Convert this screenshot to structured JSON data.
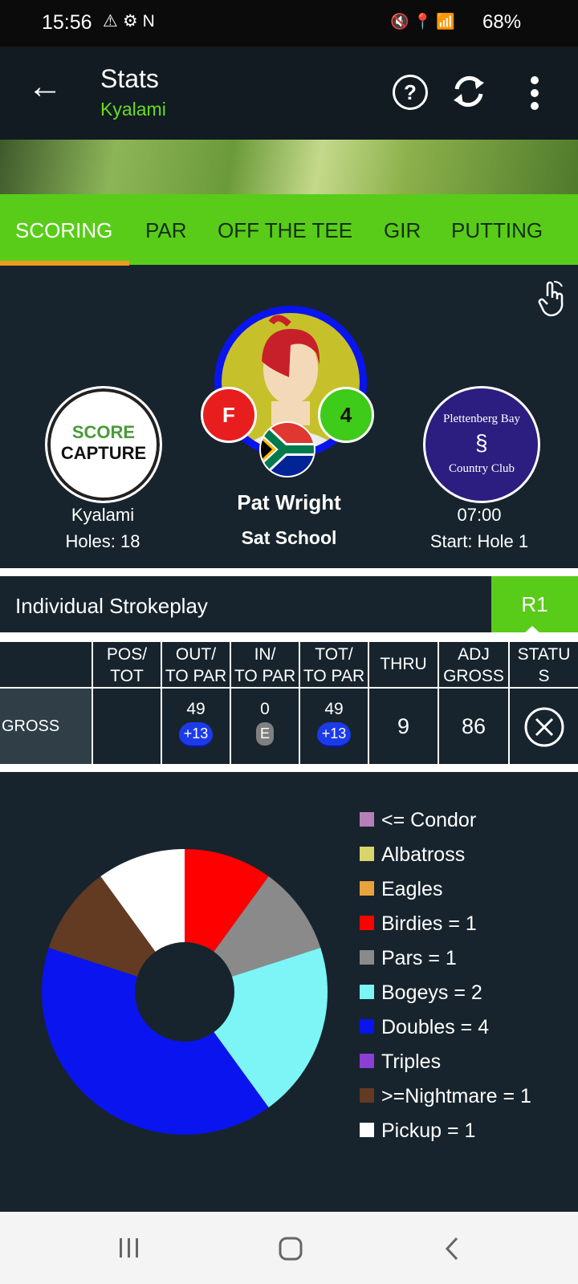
{
  "status_bar": {
    "time": "15:56",
    "battery": "68%"
  },
  "app_bar": {
    "title": "Stats",
    "subtitle": "Kyalami",
    "help": "?"
  },
  "tabs": [
    "SCORING",
    "PAR",
    "OFF THE TEE",
    "GIR",
    "PUTTING"
  ],
  "player": {
    "name": "Pat Wright",
    "school": "Sat School",
    "gender_badge": "F",
    "number_badge": "4"
  },
  "left_club": {
    "logo_line1": "SCORE",
    "logo_line2": "CAPTURE",
    "name": "Kyalami",
    "holes": "Holes: 18"
  },
  "right_club": {
    "logo_line1": "Plettenberg Bay",
    "logo_line2": "Country Club",
    "time": "07:00",
    "start": "Start: Hole 1"
  },
  "section": {
    "title": "Individual Strokeplay",
    "round_tab": "R1"
  },
  "table": {
    "headers": [
      "POS/\nTOT",
      "OUT/\nTO PAR",
      "IN/\nTO PAR",
      "TOT/\nTO PAR",
      "THRU",
      "ADJ\nGROSS",
      "STATU\nS"
    ],
    "row_label": "GROSS",
    "out_value": "49",
    "out_par": "+13",
    "in_value": "0",
    "in_par": "E",
    "tot_value": "49",
    "tot_par": "+13",
    "thru": "9",
    "adj_gross": "86"
  },
  "chart_data": {
    "type": "pie",
    "categories": [
      "<= Condor",
      "Albatross",
      "Eagles",
      "Birdies = 1",
      "Pars = 1",
      "Bogeys = 2",
      "Doubles = 4",
      "Triples",
      ">=Nightmare = 1",
      "Pickup = 1"
    ],
    "values": [
      0,
      0,
      0,
      1,
      1,
      2,
      4,
      0,
      1,
      1
    ],
    "colors": [
      "#b77fb9",
      "#d7d56b",
      "#e8a33c",
      "#ff0000",
      "#8a8a8a",
      "#7df5f7",
      "#0a14ee",
      "#8b3fd4",
      "#633a22",
      "#ffffff"
    ],
    "legend": "right"
  }
}
